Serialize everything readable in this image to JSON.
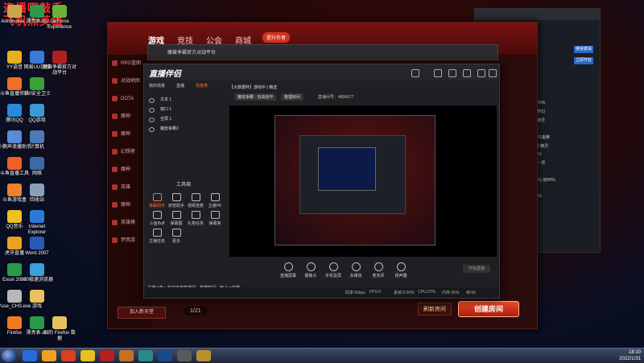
{
  "desktop": {
    "banner_line1": "连播哪敲手",
    "banner_line2": "飞机点英雄",
    "icons": [
      {
        "label": "Administra...",
        "color": "#c9a64a"
      },
      {
        "label": "漂亮表.xls",
        "color": "#2a9a4a"
      },
      {
        "label": "GeForce Experience",
        "color": "#6ab23a"
      },
      {
        "label": "YY语音",
        "color": "#e8b020"
      },
      {
        "label": "网易UU加速",
        "color": "#3a7ad8"
      },
      {
        "label": "魔兽争霸官方对战平台",
        "color": "#b02020"
      },
      {
        "label": "斗鱼直播伴侣",
        "color": "#f07020"
      },
      {
        "label": "360安全卫士",
        "color": "#3aa03a"
      },
      {
        "label": "腾讯QQ",
        "color": "#2a8ad8"
      },
      {
        "label": "QQ游戏",
        "color": "#3a9ad8"
      },
      {
        "label": "小鹅声浪播助手",
        "color": "#5a8ad8"
      },
      {
        "label": "计算机",
        "color": "#4a7ab8"
      },
      {
        "label": "斗鱼直播工具",
        "color": "#f06020"
      },
      {
        "label": "网络",
        "color": "#3a6aa8"
      },
      {
        "label": "斗鱼游戏盒",
        "color": "#f08030"
      },
      {
        "label": "回收站",
        "color": "#8aa0b8"
      },
      {
        "label": "QQ音乐",
        "color": "#f0c020"
      },
      {
        "label": "Internet Explorer",
        "color": "#2a7ad8"
      },
      {
        "label": "虎牙直播",
        "color": "#f0a020"
      },
      {
        "label": "Word 2007",
        "color": "#2a5ab8"
      },
      {
        "label": "Excel 2007",
        "color": "#2a9a4a"
      },
      {
        "label": "360极速浏览器",
        "color": "#3aa0d8"
      },
      {
        "label": "Yuse_CHS.exe",
        "color": "#b8b8b8"
      },
      {
        "label": "游戏",
        "color": "#e8c060"
      },
      {
        "label": "Firefox",
        "color": "#f07a20"
      },
      {
        "label": "漂亮表.xls",
        "color": "#2a9a4a"
      },
      {
        "label": "旧的 Firefox 数据",
        "color": "#e8c060"
      }
    ]
  },
  "platform": {
    "nav": [
      "游戏",
      "竞技",
      "公会",
      "商城"
    ],
    "badge": "提升作者",
    "sidebar": [
      "RPG蓝图",
      "对战地图",
      "DOTA",
      "魔神",
      "魔神",
      "幻想者",
      "魔神",
      "英雄",
      "魔神",
      "英雄模",
      "梦西游"
    ],
    "join_label": "加入新天堂",
    "pager": "1/21",
    "refresh_label": "刷新房间",
    "create_label": "创建房间",
    "window_title": "魔兽争霸官方对战平台"
  },
  "rightapp": {
    "lines": [
      "c455%",
      "的梦幻",
      "十精灵",
      "8",
      "RPG金牌",
      "1 十精灵",
      "RPG",
      "第一项",
      "9",
      "RPG.创RPG",
      "5",
      "RPG"
    ],
    "btn1": "接受邀请",
    "btn2": "立即开玩",
    "count": "24"
  },
  "streamer": {
    "logo": "直播伴侣",
    "tabs": [
      "我的场景",
      "直播",
      "场景类"
    ],
    "room_title": "【大数据杯】游戏中  |  精选",
    "room_meta": "直播间号：4896677",
    "room_tag1": "魔兽争霸 · 自由创作",
    "room_tag2": "整理房间",
    "scenes": [
      "文本 1",
      "窗口 1",
      "全屏 1",
      "魔兽争霸3"
    ],
    "tools_title": "工具箱",
    "tools": [
      "弹幕助手",
      "房管助手",
      "视频连麦",
      "主播PK",
      "斗鱼Buff",
      "弹幕图",
      "礼物任务",
      "弹幕答",
      "主播任务",
      "更多"
    ],
    "controls": [
      "直播屏幕",
      "摄像头",
      "手机投屏",
      "多媒体",
      "麦克风",
      "扬声器"
    ],
    "start_live": "开始直播",
    "status": [
      "码率:0kbps",
      "FPS:0",
      "丢帧:0.00%",
      "CPU:27%",
      "内存:35%",
      "帧:60"
    ],
    "chat_hint": "主播公告：欢迎来到直播间，直播时间：晚上一定哦",
    "mini_title": "网络，获取首页平台选择中，登录成功"
  },
  "taskbar": {
    "time": "18:10",
    "date": "2022/1/31",
    "apps": [
      "#2a6ad8",
      "#f0a020",
      "#d84020",
      "#e8c020",
      "#b02020",
      "#c87020",
      "#2a8a8a",
      "#1a4a8a",
      "#5a5a5a",
      "#b89030"
    ]
  }
}
